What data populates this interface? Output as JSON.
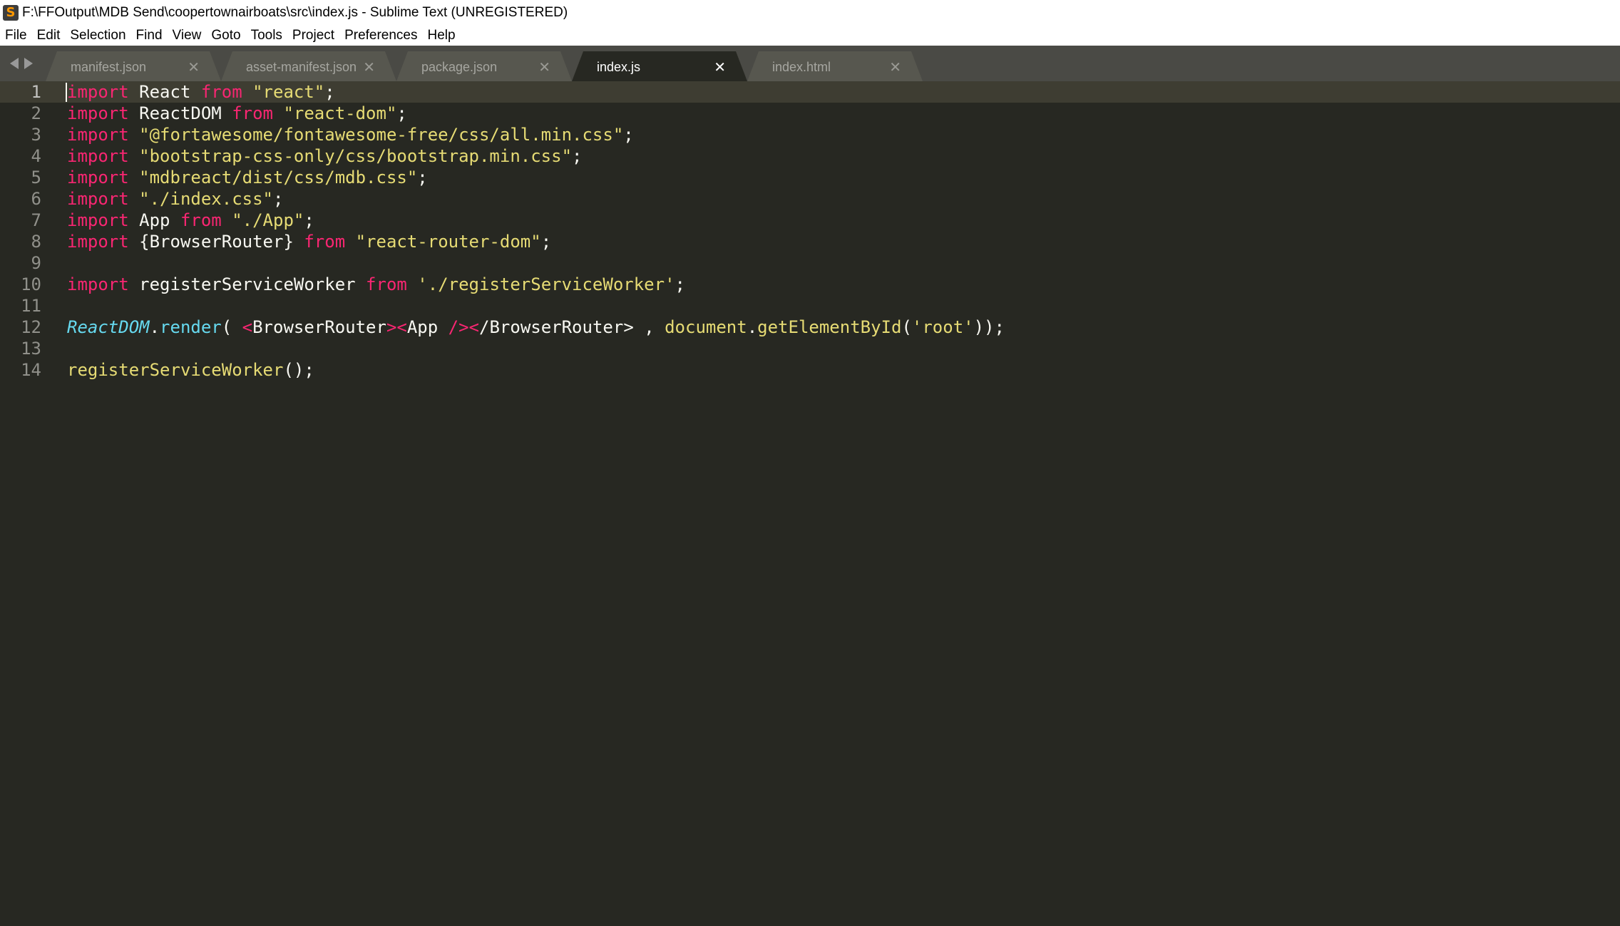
{
  "window": {
    "title": "F:\\FFOutput\\MDB Send\\coopertownairboats\\src\\index.js - Sublime Text (UNREGISTERED)"
  },
  "menu": [
    "File",
    "Edit",
    "Selection",
    "Find",
    "View",
    "Goto",
    "Tools",
    "Project",
    "Preferences",
    "Help"
  ],
  "tabs": [
    {
      "label": "manifest.json",
      "active": false
    },
    {
      "label": "asset-manifest.json",
      "active": false
    },
    {
      "label": "package.json",
      "active": false
    },
    {
      "label": "index.js",
      "active": true
    },
    {
      "label": "index.html",
      "active": false
    }
  ],
  "tab_close_glyph": "✕",
  "code": {
    "current_line": 1,
    "line_numbers": [
      "1",
      "2",
      "3",
      "4",
      "5",
      "6",
      "7",
      "8",
      "9",
      "10",
      "11",
      "12",
      "13",
      "14"
    ],
    "lines": [
      [
        {
          "t": "import",
          "c": "kw"
        },
        {
          "t": " React ",
          "c": "plain"
        },
        {
          "t": "from",
          "c": "kw"
        },
        {
          "t": " ",
          "c": "plain"
        },
        {
          "t": "\"react\"",
          "c": "str"
        },
        {
          "t": ";",
          "c": "plain"
        }
      ],
      [
        {
          "t": "import",
          "c": "kw"
        },
        {
          "t": " ReactDOM ",
          "c": "plain"
        },
        {
          "t": "from",
          "c": "kw"
        },
        {
          "t": " ",
          "c": "plain"
        },
        {
          "t": "\"react-dom\"",
          "c": "str"
        },
        {
          "t": ";",
          "c": "plain"
        }
      ],
      [
        {
          "t": "import",
          "c": "kw"
        },
        {
          "t": " ",
          "c": "plain"
        },
        {
          "t": "\"@fortawesome/fontawesome-free/css/all.min.css\"",
          "c": "str"
        },
        {
          "t": ";",
          "c": "plain"
        }
      ],
      [
        {
          "t": "import",
          "c": "kw"
        },
        {
          "t": " ",
          "c": "plain"
        },
        {
          "t": "\"bootstrap-css-only/css/bootstrap.min.css\"",
          "c": "str"
        },
        {
          "t": ";",
          "c": "plain"
        }
      ],
      [
        {
          "t": "import",
          "c": "kw"
        },
        {
          "t": " ",
          "c": "plain"
        },
        {
          "t": "\"mdbreact/dist/css/mdb.css\"",
          "c": "str"
        },
        {
          "t": ";",
          "c": "plain"
        }
      ],
      [
        {
          "t": "import",
          "c": "kw"
        },
        {
          "t": " ",
          "c": "plain"
        },
        {
          "t": "\"./index.css\"",
          "c": "str"
        },
        {
          "t": ";",
          "c": "plain"
        }
      ],
      [
        {
          "t": "import",
          "c": "kw"
        },
        {
          "t": " App ",
          "c": "plain"
        },
        {
          "t": "from",
          "c": "kw"
        },
        {
          "t": " ",
          "c": "plain"
        },
        {
          "t": "\"./App\"",
          "c": "str"
        },
        {
          "t": ";",
          "c": "plain"
        }
      ],
      [
        {
          "t": "import",
          "c": "kw"
        },
        {
          "t": " {BrowserRouter} ",
          "c": "plain"
        },
        {
          "t": "from",
          "c": "kw"
        },
        {
          "t": " ",
          "c": "plain"
        },
        {
          "t": "\"react-router-dom\"",
          "c": "str"
        },
        {
          "t": ";",
          "c": "plain"
        }
      ],
      [],
      [
        {
          "t": "import",
          "c": "kw"
        },
        {
          "t": " registerServiceWorker ",
          "c": "plain"
        },
        {
          "t": "from",
          "c": "kw"
        },
        {
          "t": " ",
          "c": "plain"
        },
        {
          "t": "'./registerServiceWorker'",
          "c": "str"
        },
        {
          "t": ";",
          "c": "plain"
        }
      ],
      [],
      [
        {
          "t": "ReactDOM",
          "c": "cls"
        },
        {
          "t": ".",
          "c": "plain"
        },
        {
          "t": "render",
          "c": "fn"
        },
        {
          "t": "( ",
          "c": "plain"
        },
        {
          "t": "<",
          "c": "tag"
        },
        {
          "t": "BrowserRouter",
          "c": "plain"
        },
        {
          "t": "><",
          "c": "tag"
        },
        {
          "t": "App ",
          "c": "plain"
        },
        {
          "t": "/><",
          "c": "tag"
        },
        {
          "t": "/BrowserRouter",
          "c": "plain"
        },
        {
          "t": "> , ",
          "c": "plain"
        },
        {
          "t": "document",
          "c": "call"
        },
        {
          "t": ".",
          "c": "plain"
        },
        {
          "t": "getElementById",
          "c": "call"
        },
        {
          "t": "(",
          "c": "plain"
        },
        {
          "t": "'root'",
          "c": "str"
        },
        {
          "t": "));",
          "c": "plain"
        }
      ],
      [],
      [
        {
          "t": "registerServiceWorker",
          "c": "call"
        },
        {
          "t": "();",
          "c": "plain"
        }
      ]
    ]
  }
}
